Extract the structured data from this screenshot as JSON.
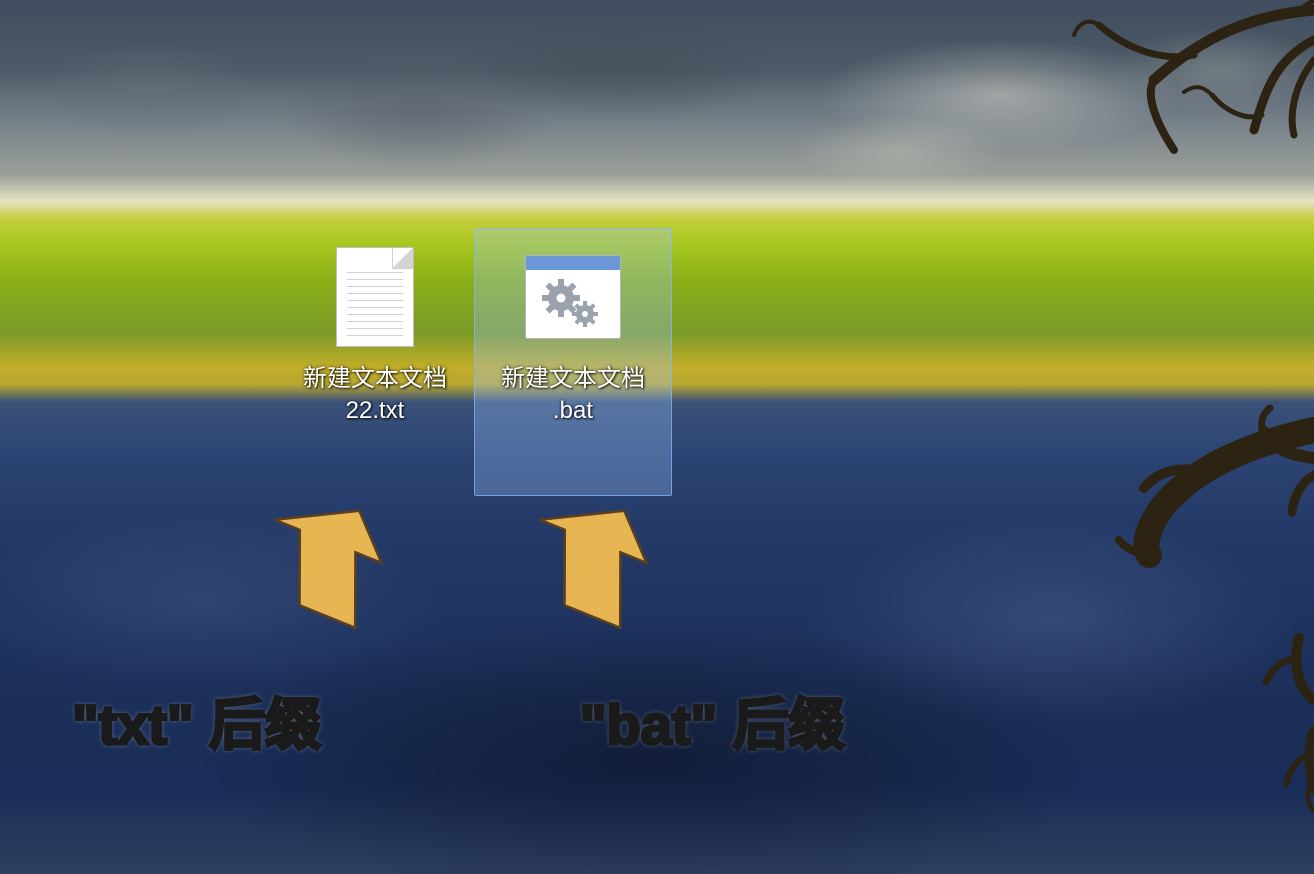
{
  "desktop": {
    "icons": [
      {
        "id": "txt-file",
        "label": "新建文本文档\n22.txt",
        "type": "txt",
        "selected": false
      },
      {
        "id": "bat-file",
        "label": "新建文本文档\n.bat",
        "type": "bat",
        "selected": true
      }
    ]
  },
  "annotations": {
    "left_label": "\"txt\" 后缀",
    "right_label": "\"bat\" 后缀"
  }
}
